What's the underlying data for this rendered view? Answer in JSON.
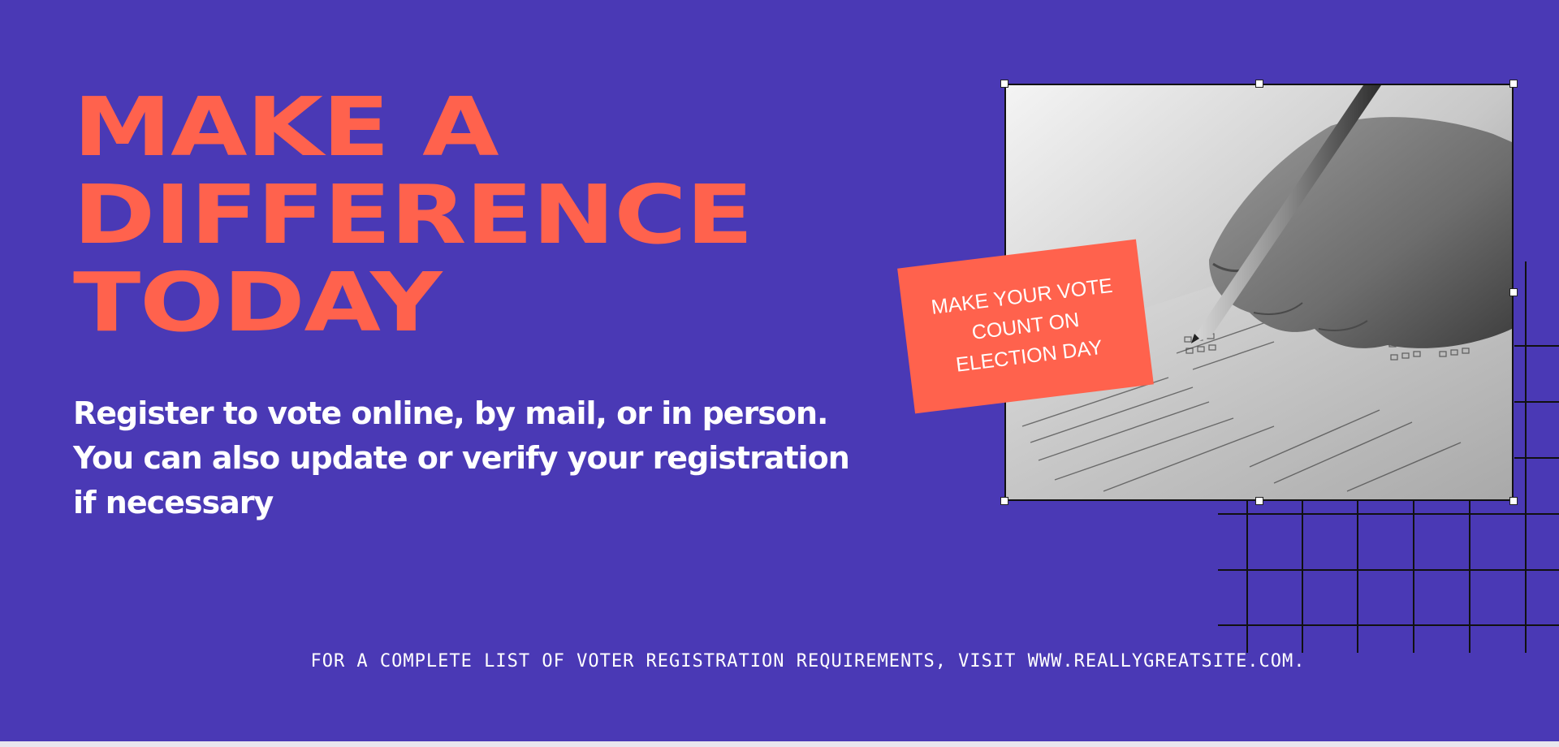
{
  "headline": {
    "line1": "MAKE A",
    "line2": "DIFFERENCE",
    "line3": "TODAY"
  },
  "subtext": {
    "line1": "Register to vote online, by mail, or in person.",
    "line2": "You can also update or verify your registration",
    "line3": "if necessary"
  },
  "sticker": {
    "text": "MAKE YOUR VOTE COUNT ON ELECTION DAY"
  },
  "footer": {
    "text": "FOR A COMPLETE LIST OF VOTER REGISTRATION REQUIREMENTS, VISIT WWW.REALLYGREATSITE.COM."
  },
  "photo": {
    "subject": "hand-writing-on-ballot"
  },
  "colors": {
    "background": "#4A39B5",
    "accent": "#FF624D",
    "text": "#FFFFFF",
    "grid_lines": "#111111"
  }
}
